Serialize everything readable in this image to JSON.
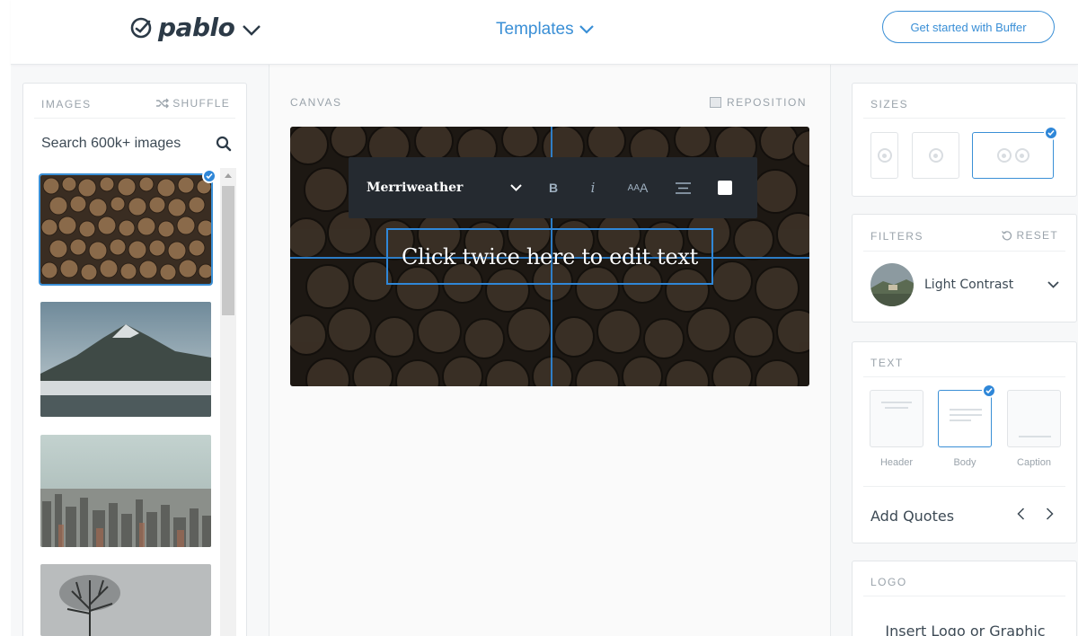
{
  "header": {
    "brand": "pablo",
    "templates_label": "Templates",
    "cta_label": "Get started with Buffer"
  },
  "images_panel": {
    "title": "IMAGES",
    "shuffle_label": "SHUFFLE",
    "search_placeholder": "Search 600k+ images",
    "thumbnails": [
      {
        "subject": "stacked firewood logs",
        "selected": true
      },
      {
        "subject": "misty mountain peak over lake",
        "selected": false
      },
      {
        "subject": "city skyline from above",
        "selected": false
      },
      {
        "subject": "bare tree in fog",
        "selected": false
      }
    ]
  },
  "canvas": {
    "label": "CANVAS",
    "reposition_label": "REPOSITION",
    "text": "Click twice here to edit text",
    "toolbar": {
      "font_name": "Merriweather",
      "bold": "B",
      "italic": "i",
      "size_small": "A",
      "size_large": "A",
      "size_prefix": "A"
    }
  },
  "sizes_panel": {
    "title": "SIZES",
    "options": [
      "pinterest",
      "instagram",
      "facebook-twitter"
    ],
    "selected": "facebook-twitter"
  },
  "filters_panel": {
    "title": "FILTERS",
    "reset_label": "RESET",
    "selected_filter": "Light Contrast"
  },
  "text_panel": {
    "title": "TEXT",
    "options": [
      {
        "label": "Header",
        "selected": false
      },
      {
        "label": "Body",
        "selected": true
      },
      {
        "label": "Caption",
        "selected": false
      }
    ],
    "add_quotes_label": "Add Quotes"
  },
  "logo_panel": {
    "title": "LOGO",
    "insert_label": "Insert Logo or Graphic"
  },
  "colors": {
    "accent": "#3a8fd6",
    "check_badge": "#2f87d8",
    "toolbar_bg": "#252a30"
  }
}
